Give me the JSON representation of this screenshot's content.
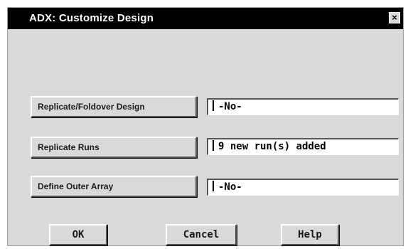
{
  "window": {
    "title": "ADX: Customize Design",
    "close_glyph": "×"
  },
  "rows": [
    {
      "button_label": "Replicate/Foldover Design",
      "value": "-No-"
    },
    {
      "button_label": "Replicate Runs",
      "value": "9 new run(s) added"
    },
    {
      "button_label": "Define Outer Array",
      "value": "-No-"
    }
  ],
  "actions": {
    "ok": "OK",
    "cancel": "Cancel",
    "help": "Help"
  },
  "colors": {
    "titlebar_bg": "#000000",
    "dialog_bg": "#d9d9d9",
    "field_bg": "#ffffff"
  },
  "icons": {
    "close": "close-icon"
  }
}
